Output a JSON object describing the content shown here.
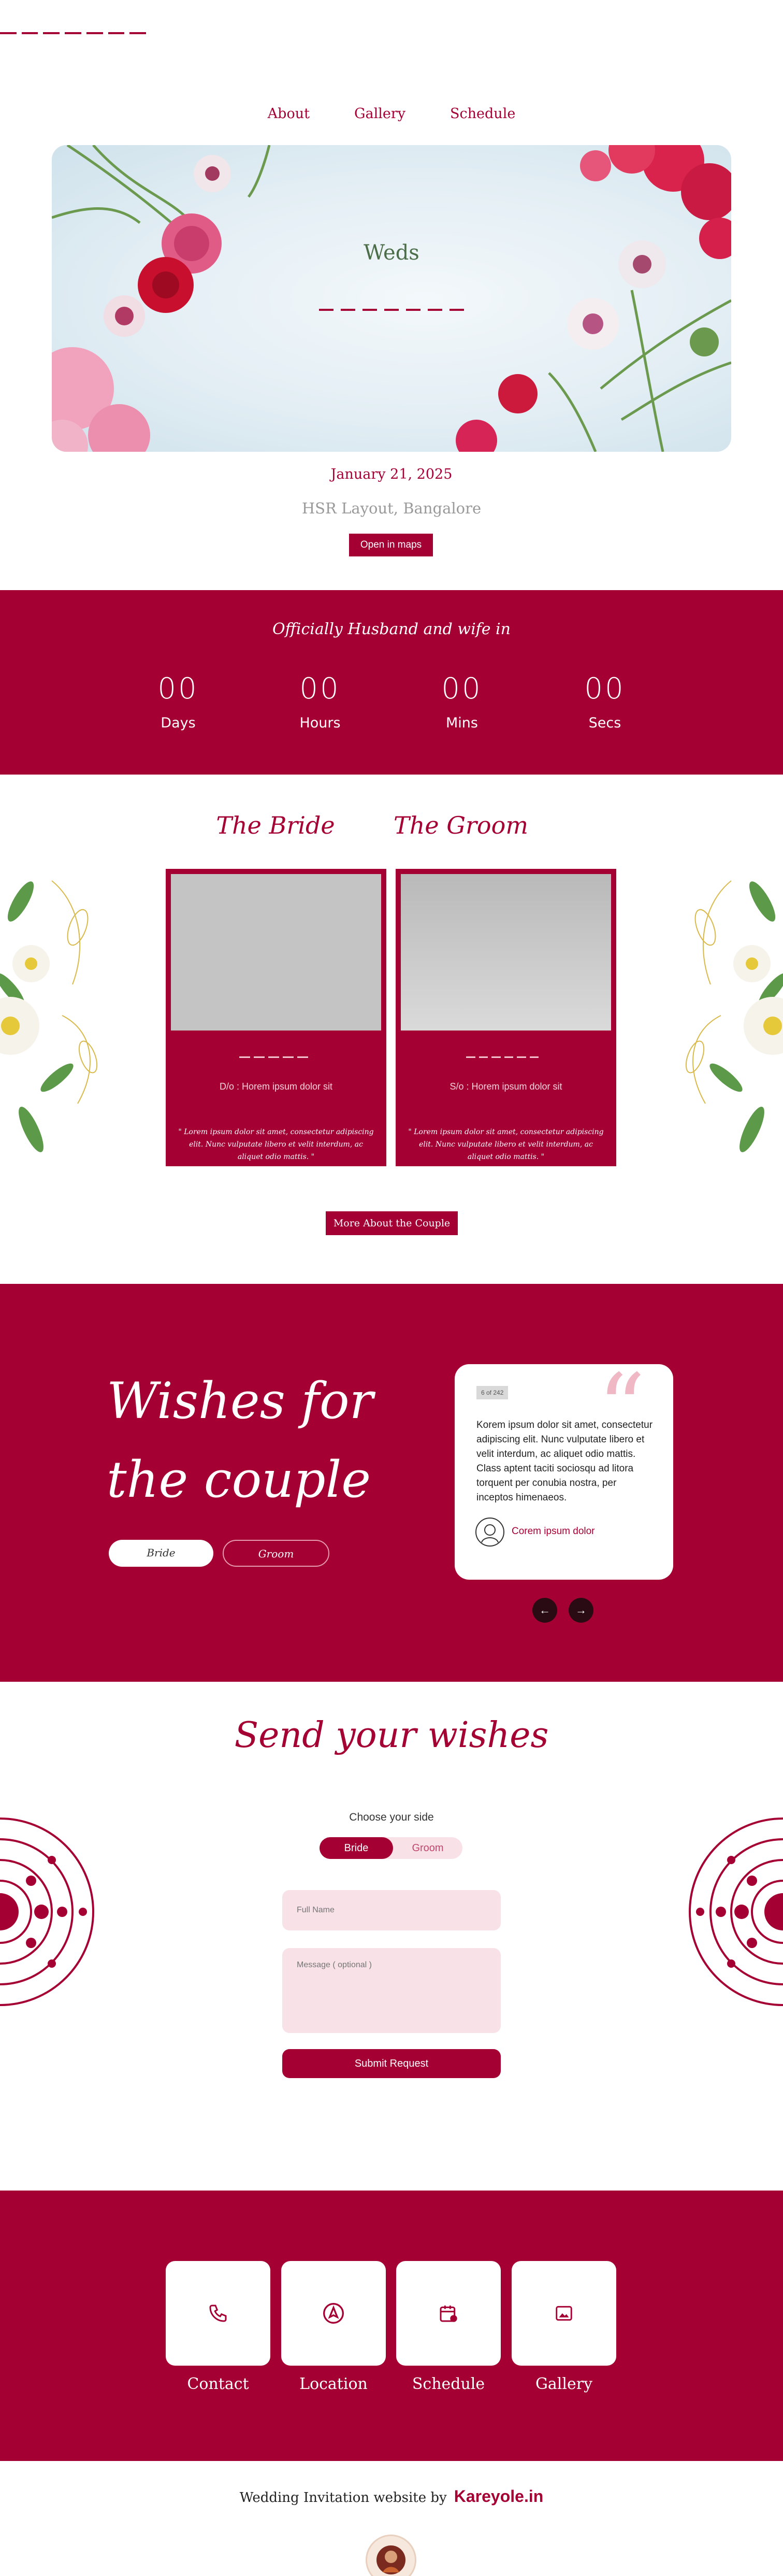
{
  "nav": {
    "items": [
      "About",
      "Gallery",
      "Schedule"
    ]
  },
  "hero": {
    "title": "Weds"
  },
  "event": {
    "date": "January 21, 2025",
    "venue": "HSR Layout, Bangalore",
    "map_button": "Open in maps"
  },
  "countdown": {
    "title": "Officially Husband and wife in",
    "items": [
      {
        "value": "00",
        "label": "Days"
      },
      {
        "value": "00",
        "label": "Hours"
      },
      {
        "value": "00",
        "label": "Mins"
      },
      {
        "value": "00",
        "label": "Secs"
      }
    ]
  },
  "couple": {
    "bride": {
      "heading": "The Bride",
      "parents": "D/o :  Horem ipsum dolor sit",
      "desc": "\" Lorem ipsum dolor sit amet, consectetur adipiscing elit. Nunc vulputate libero et velit interdum, ac aliquet odio mattis. \""
    },
    "groom": {
      "heading": "The Groom",
      "parents": "S/o :  Horem ipsum dolor sit",
      "desc": "\" Lorem ipsum dolor sit amet, consectetur adipiscing elit. Nunc vulputate libero et velit interdum, ac aliquet odio mattis. \""
    },
    "more_button": "More About the Couple"
  },
  "wishes": {
    "title_line1": "Wishes for",
    "title_line2": "the couple",
    "toggle_bride": "Bride",
    "toggle_groom": "Groom",
    "card": {
      "tag": "6 of 242",
      "text": "Korem ipsum dolor sit amet, consectetur adipiscing elit. Nunc vulputate libero et velit interdum, ac aliquet odio mattis. Class aptent taciti sociosqu ad litora torquent per conubia nostra, per inceptos himenaeos.",
      "author": "Corem ipsum dolor"
    },
    "prev": "←",
    "next": "→"
  },
  "send": {
    "title": "Send your wishes",
    "choose_label": "Choose your side",
    "side_bride": "Bride",
    "side_groom": "Groom",
    "name_placeholder": "Full Name",
    "message_placeholder": "Message ( optional )",
    "submit": "Submit Request"
  },
  "footer": {
    "tiles": [
      {
        "label": "Contact",
        "icon": "phone-icon"
      },
      {
        "label": "Location",
        "icon": "navigation-icon"
      },
      {
        "label": "Schedule",
        "icon": "calendar-icon"
      },
      {
        "label": "Gallery",
        "icon": "image-icon"
      }
    ],
    "credit_text": "Wedding Invitation website by",
    "credit_brand": "Kareyole.in"
  },
  "colors": {
    "accent": "#a50034",
    "soft_pink": "#f8e1e7"
  }
}
